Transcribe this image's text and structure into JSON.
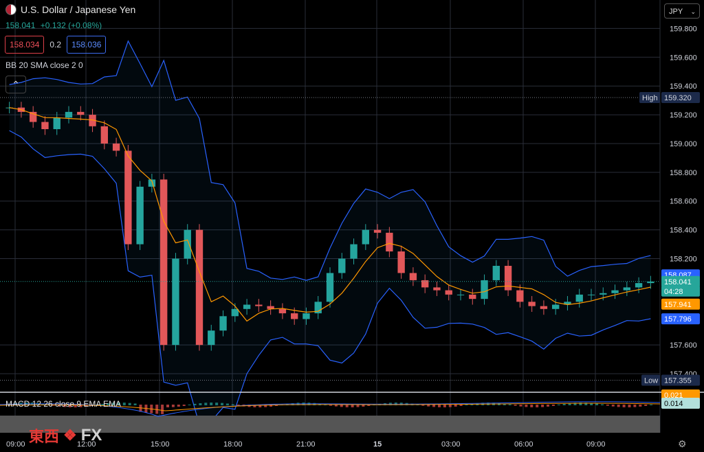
{
  "header": {
    "title": "U.S. Dollar / Japanese Yen",
    "price": "158.041",
    "change": "+0.132 (+0.08%)",
    "bid": "158.034",
    "spread": "0.2",
    "ask": "158.036",
    "indicator_label": "BB 20 SMA close 2 0",
    "currency_select": "JPY",
    "macd_label": "MACD 12 26 close 9 EMA EMA"
  },
  "watermark": {
    "cn": "東西",
    "fx": "FX"
  },
  "colors": {
    "up": "#26a69a",
    "down": "#ef5350",
    "band": "#2962ff",
    "sma": "#ff9800",
    "grid": "#2a2e39"
  },
  "chart_data": {
    "type": "candlestick",
    "title": "U.S. Dollar / Japanese Yen",
    "ylim": [
      157.3,
      159.95
    ],
    "y_ticks": [
      "159.800",
      "159.600",
      "159.400",
      "159.200",
      "159.000",
      "158.800",
      "158.600",
      "158.400",
      "158.200",
      "157.600",
      "157.400"
    ],
    "x_ticks": [
      "09:00",
      "12:00",
      "15:00",
      "18:00",
      "21:00",
      "15",
      "03:00",
      "06:00",
      "09:00"
    ],
    "x_tick_bold": "15",
    "markers": {
      "high": {
        "label": "High",
        "value": "159.320"
      },
      "low": {
        "label": "Low",
        "value": "157.355"
      },
      "upper_band": "158.087",
      "last": "158.041",
      "countdown": "04:28",
      "sma": "157.941",
      "lower_band": "157.796"
    },
    "series": [
      {
        "name": "USD/JPY",
        "approx_closes": [
          159.25,
          159.22,
          159.15,
          159.1,
          159.18,
          159.22,
          159.2,
          159.12,
          159.0,
          158.95,
          158.3,
          158.7,
          158.75,
          157.6,
          158.2,
          158.4,
          157.6,
          157.7,
          157.8,
          157.85,
          157.88,
          157.87,
          157.85,
          157.82,
          157.78,
          157.82,
          157.9,
          158.1,
          158.2,
          158.3,
          158.4,
          158.38,
          158.25,
          158.1,
          158.05,
          158.0,
          157.98,
          157.95,
          157.95,
          157.92,
          158.05,
          158.15,
          157.98,
          157.9,
          157.87,
          157.85,
          157.88,
          157.9,
          157.95,
          157.95,
          157.96,
          157.98,
          158.0,
          158.03,
          158.04
        ]
      }
    ],
    "macd_values": {
      "signal": "0.021",
      "macd": "0.014"
    }
  }
}
